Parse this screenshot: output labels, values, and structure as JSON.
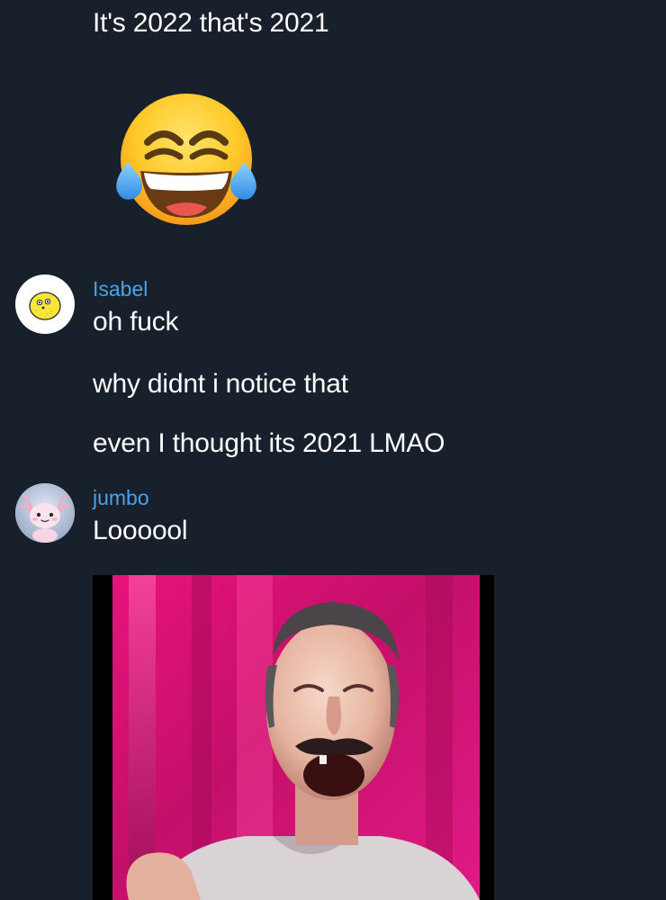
{
  "messages": {
    "prev_text": "It's 2022 that's 2021",
    "prev_sticker": "face-with-tears-of-joy-emoji",
    "isabel": {
      "username": "Isabel",
      "avatar": "lemon-avatar",
      "lines": [
        "oh fuck",
        "why didnt i notice that",
        "even I thought its 2021 LMAO"
      ]
    },
    "jumbo": {
      "username": "jumbo",
      "avatar": "axolotl-avatar",
      "text": "Loooool",
      "attachment": "laughing-man-gif"
    }
  },
  "colors": {
    "background": "#18202b",
    "username": "#4aa3ec",
    "text": "#ffffff"
  }
}
